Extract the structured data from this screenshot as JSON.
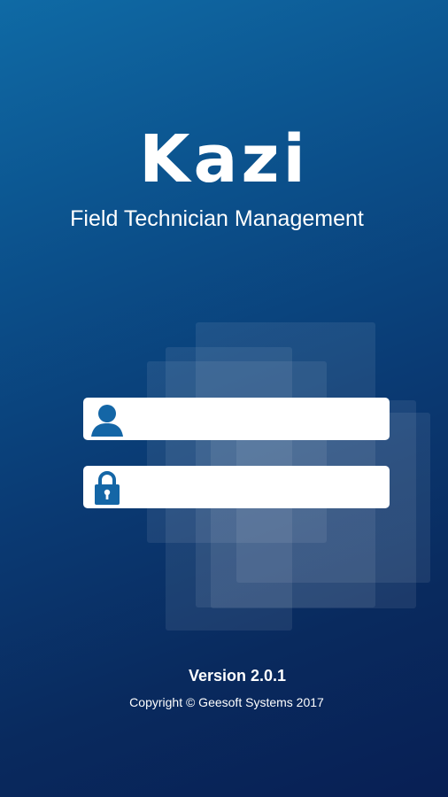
{
  "app": {
    "name": "Kazi",
    "tagline": "Field Technician Management"
  },
  "login": {
    "username": {
      "icon": "user-icon",
      "value": "",
      "placeholder": ""
    },
    "password": {
      "icon": "lock-icon",
      "value": "",
      "placeholder": ""
    }
  },
  "footer": {
    "version": "Version 2.0.1",
    "copyright": "Copyright © Geesoft Systems 2017"
  },
  "colors": {
    "background_top": "#0f6aa5",
    "background_bottom": "#081f54",
    "icon_blue": "#1466a6",
    "field_background": "#ffffff"
  }
}
